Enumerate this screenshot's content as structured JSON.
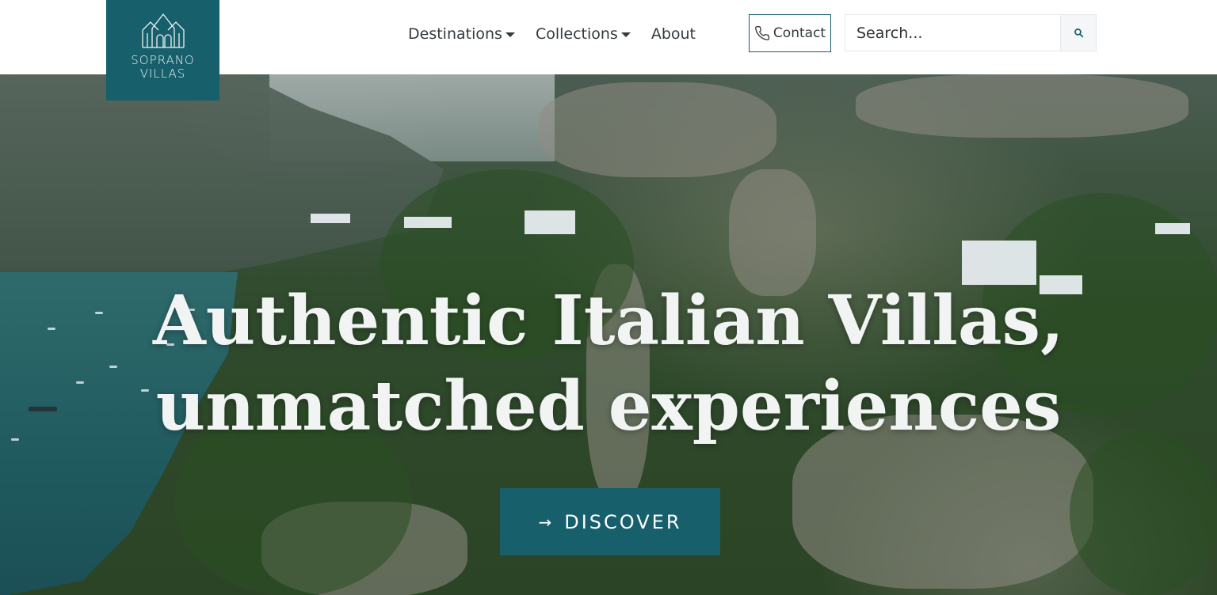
{
  "brand": {
    "line1": "SOPRANO",
    "line2": "VILLAS",
    "color": "#165f6b",
    "icon": "villa-logo-icon"
  },
  "nav": {
    "items": [
      {
        "label": "Destinations",
        "has_dropdown": true
      },
      {
        "label": "Collections",
        "has_dropdown": true
      },
      {
        "label": "About",
        "has_dropdown": false
      }
    ]
  },
  "contact": {
    "label": "Contact",
    "icon": "phone-icon"
  },
  "search": {
    "placeholder": "Search...",
    "icon": "search-icon"
  },
  "hero": {
    "headline_line1": "Authentic Italian Villas,",
    "headline_line2": "unmatched experiences",
    "cta_label": "DISCOVER",
    "cta_icon": "arrow-right-icon"
  }
}
